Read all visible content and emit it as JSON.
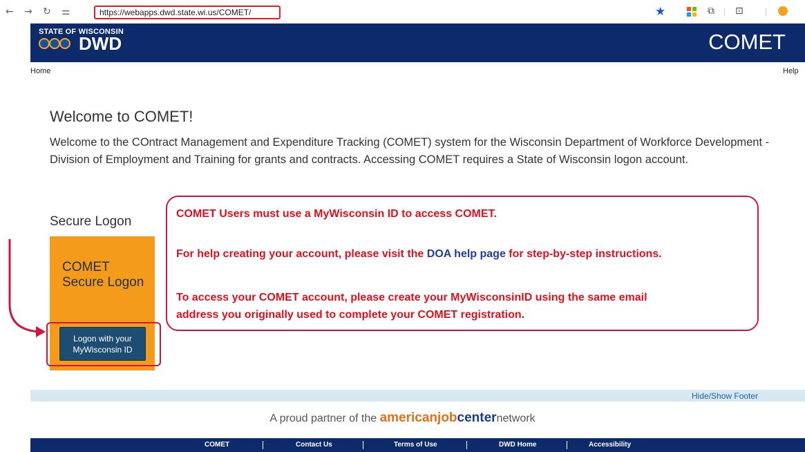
{
  "browser": {
    "url": "https://webapps.dwd.state.wi.us/COMET/",
    "back_glyph": "←",
    "forward_glyph": "→",
    "reload_glyph": "↻",
    "site_settings_glyph": "⚌"
  },
  "header": {
    "state_label": "STATE OF WISCONSIN",
    "agency_label": "DWD",
    "app_title": "COMET"
  },
  "nav": {
    "home": "Home",
    "help": "Help"
  },
  "main": {
    "title": "Welcome to COMET!",
    "intro": "Welcome to the COntract Management and Expenditure Tracking (COMET) system for the Wisconsin Department of Workforce Development - Division of Employment and Training for grants and contracts. Accessing COMET requires a State of Wisconsin logon account."
  },
  "logon": {
    "heading": "Secure Logon",
    "panel_title": "COMET Secure Logon",
    "button_line1": "Logon with your",
    "button_line2": "MyWisconsin ID"
  },
  "notice": {
    "line1": "COMET Users must use a MyWisconsin ID to access COMET.",
    "line2_before": "For help creating your account, please visit the ",
    "line2_link": "DOA help page",
    "line2_after": " for step-by-step instructions.",
    "line3": "To access your COMET account, please create your MyWisconsinID using the same email",
    "line4": "address you originally used to complete your COMET registration."
  },
  "footer": {
    "toggle": "Hide/Show Footer",
    "partner_prefix": "A proud partner of the ",
    "partner_american": "american",
    "partner_job": "job",
    "partner_center": "center",
    "partner_network": "network",
    "links": [
      "COMET",
      "Contact Us",
      "Terms of Use",
      "DWD Home",
      "Accessibility"
    ]
  },
  "colors": {
    "header_navy": "#0d2b6b",
    "panel_orange": "#f59b1c",
    "notice_red": "#e0101e",
    "button_blue": "#1d4e72"
  }
}
